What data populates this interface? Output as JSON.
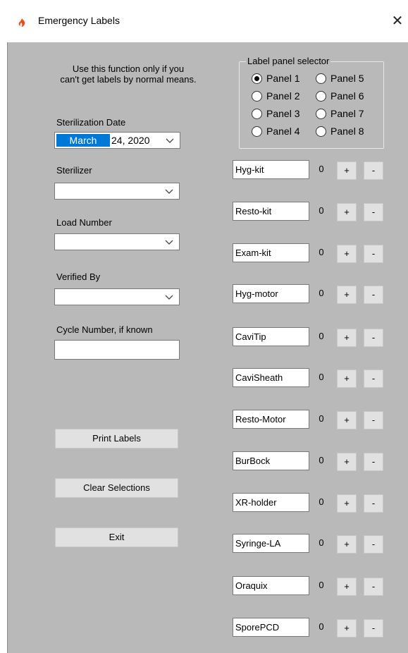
{
  "window": {
    "title": "Emergency Labels",
    "close_glyph": "✕",
    "icon": "app-flame-icon",
    "accent": "#0078d7",
    "background": "#b9b9b9"
  },
  "instructions": {
    "line1": "Use this function only if you",
    "line2": "can't get labels by normal means."
  },
  "sterilization_date": {
    "label": "Sterilization Date",
    "month": "March",
    "rest": "24, 2020"
  },
  "sterilizer": {
    "label": "Sterilizer",
    "value": ""
  },
  "load_number": {
    "label": "Load Number",
    "value": ""
  },
  "verified_by": {
    "label": "Verified By",
    "value": ""
  },
  "cycle_number": {
    "label": "Cycle Number, if known",
    "value": ""
  },
  "buttons": {
    "print": "Print Labels",
    "clear": "Clear Selections",
    "exit": "Exit"
  },
  "panel_selector": {
    "legend": "Label panel selector",
    "selected": "Panel 1",
    "options": [
      "Panel 1",
      "Panel 2",
      "Panel 3",
      "Panel 4",
      "Panel 5",
      "Panel 6",
      "Panel 7",
      "Panel 8"
    ]
  },
  "kits": [
    {
      "name": "Hyg-kit",
      "count": "0",
      "plus": "+",
      "minus": "-"
    },
    {
      "name": "Resto-kit",
      "count": "0",
      "plus": "+",
      "minus": "-"
    },
    {
      "name": "Exam-kit",
      "count": "0",
      "plus": "+",
      "minus": "-"
    },
    {
      "name": "Hyg-motor",
      "count": "0",
      "plus": "+",
      "minus": "-"
    },
    {
      "name": "CaviTip",
      "count": "0",
      "plus": "+",
      "minus": "-"
    },
    {
      "name": "CaviSheath",
      "count": "0",
      "plus": "+",
      "minus": "-"
    },
    {
      "name": "Resto-Motor",
      "count": "0",
      "plus": "+",
      "minus": "-"
    },
    {
      "name": "BurBock",
      "count": "0",
      "plus": "+",
      "minus": "-"
    },
    {
      "name": "XR-holder",
      "count": "0",
      "plus": "+",
      "minus": "-"
    },
    {
      "name": "Syringe-LA",
      "count": "0",
      "plus": "+",
      "minus": "-"
    },
    {
      "name": "Oraquix",
      "count": "0",
      "plus": "+",
      "minus": "-"
    },
    {
      "name": "SporePCD",
      "count": "0",
      "plus": "+",
      "minus": "-"
    }
  ]
}
